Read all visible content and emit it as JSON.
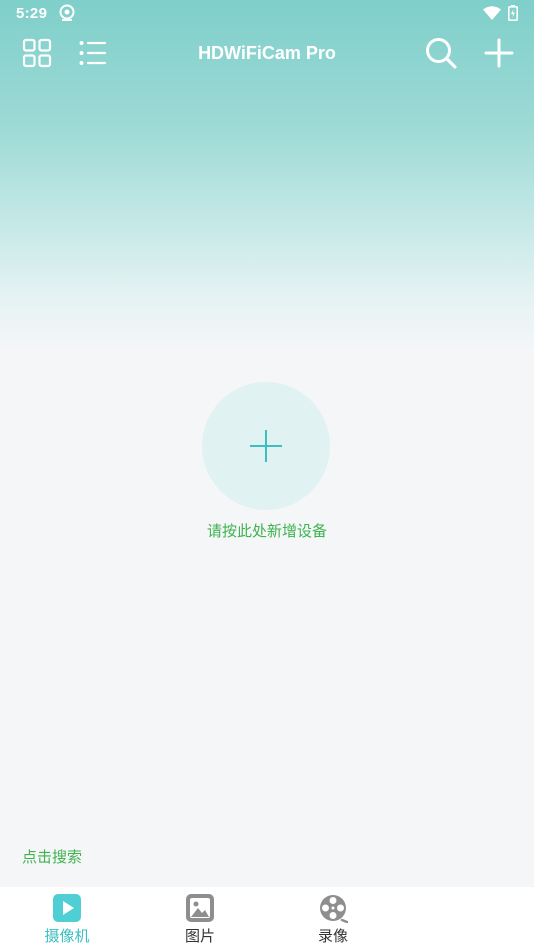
{
  "status_bar": {
    "time": "5:29",
    "icons": [
      "app-notification-icon",
      "wifi-icon",
      "battery-icon"
    ]
  },
  "toolbar": {
    "title": "HDWiFiCam Pro",
    "icons": [
      "grid-view-icon",
      "list-view-icon",
      "search-icon",
      "plus-icon"
    ]
  },
  "main": {
    "add_device_label": "请按此处新增设备",
    "search_hint": "点击搜索"
  },
  "bottom_nav": {
    "items": [
      {
        "label": "摄像机",
        "icon": "camera-play-icon",
        "active": true
      },
      {
        "label": "图片",
        "icon": "image-icon",
        "active": false
      },
      {
        "label": "录像",
        "icon": "film-reel-icon",
        "active": false
      }
    ]
  },
  "colors": {
    "header_teal": "#7fcfca",
    "accent_cyan": "#3bbfc3",
    "link_green": "#3fb34f",
    "circle_bg": "#e1f2f3",
    "page_bg": "#f4f6f8"
  }
}
